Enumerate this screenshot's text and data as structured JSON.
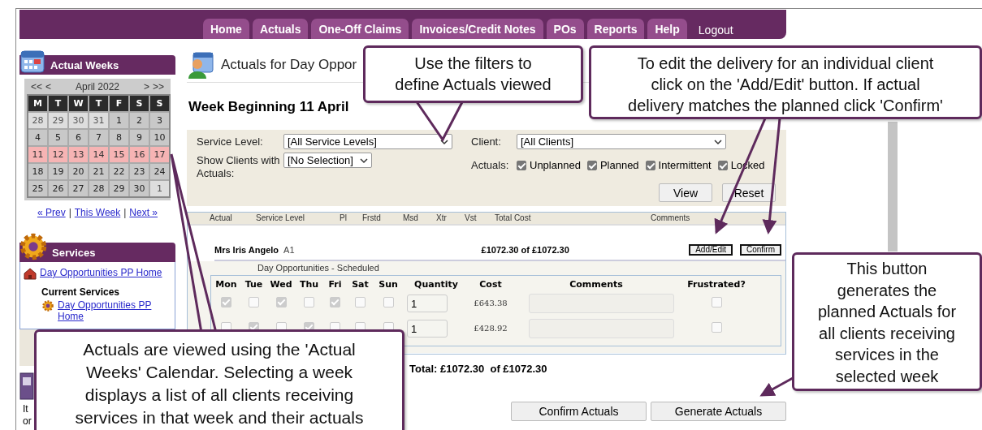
{
  "nav": [
    {
      "label": "Home",
      "kind": "tab"
    },
    {
      "label": "Actuals",
      "kind": "tab"
    },
    {
      "label": "One-Off Claims",
      "kind": "tab"
    },
    {
      "label": "Invoices/Credit Notes",
      "kind": "tab"
    },
    {
      "label": "POs",
      "kind": "tab"
    },
    {
      "label": "Reports",
      "kind": "tab"
    },
    {
      "label": "Help",
      "kind": "tab"
    },
    {
      "label": "Logout",
      "kind": "link"
    }
  ],
  "sidebar": {
    "calendar_panel": {
      "title": "Actual Weeks",
      "prev_year": "<<",
      "prev_month": "<",
      "month": "April 2022",
      "next_month": ">",
      "next_year": ">>",
      "weekdays": [
        "M",
        "T",
        "W",
        "T",
        "F",
        "S",
        "S"
      ],
      "weeks": [
        {
          "selected": false,
          "days": [
            {
              "label": "28",
              "other_month": true
            },
            {
              "label": "29",
              "other_month": true
            },
            {
              "label": "30",
              "other_month": true
            },
            {
              "label": "31",
              "other_month": true
            },
            {
              "label": "1",
              "other_month": false
            },
            {
              "label": "2",
              "other_month": false
            },
            {
              "label": "3",
              "other_month": false
            }
          ]
        },
        {
          "selected": false,
          "days": [
            {
              "label": "4",
              "other_month": false
            },
            {
              "label": "5",
              "other_month": false
            },
            {
              "label": "6",
              "other_month": false
            },
            {
              "label": "7",
              "other_month": false
            },
            {
              "label": "8",
              "other_month": false
            },
            {
              "label": "9",
              "other_month": false
            },
            {
              "label": "10",
              "other_month": false
            }
          ]
        },
        {
          "selected": true,
          "days": [
            {
              "label": "11",
              "other_month": false
            },
            {
              "label": "12",
              "other_month": false
            },
            {
              "label": "13",
              "other_month": false
            },
            {
              "label": "14",
              "other_month": false
            },
            {
              "label": "15",
              "other_month": false
            },
            {
              "label": "16",
              "other_month": false
            },
            {
              "label": "17",
              "other_month": false
            }
          ]
        },
        {
          "selected": false,
          "days": [
            {
              "label": "18",
              "other_month": false
            },
            {
              "label": "19",
              "other_month": false
            },
            {
              "label": "20",
              "other_month": false
            },
            {
              "label": "21",
              "other_month": false
            },
            {
              "label": "22",
              "other_month": false
            },
            {
              "label": "23",
              "other_month": false
            },
            {
              "label": "24",
              "other_month": false
            }
          ]
        },
        {
          "selected": false,
          "days": [
            {
              "label": "25",
              "other_month": false
            },
            {
              "label": "26",
              "other_month": false
            },
            {
              "label": "27",
              "other_month": false
            },
            {
              "label": "28",
              "other_month": false
            },
            {
              "label": "29",
              "other_month": false
            },
            {
              "label": "30",
              "other_month": false
            },
            {
              "label": "1",
              "other_month": true
            }
          ]
        }
      ],
      "links": [
        "« Prev",
        "This Week",
        "Next »"
      ],
      "separator": "|"
    },
    "services": {
      "title": "Services",
      "home_link": "Day Opportunities PP Home",
      "current_heading": "Current Services",
      "current_links": [
        "Day Opportunities PP Home"
      ]
    },
    "cut_text": [
      "It",
      "or"
    ]
  },
  "main": {
    "title": "Actuals for Day Oppor",
    "week_heading": "Week Beginning 11 April",
    "filters": {
      "service_level": {
        "label": "Service Level:",
        "value": "[All Service Levels]"
      },
      "client": {
        "label": "Client:",
        "value": "[All Clients]"
      },
      "show_clients": {
        "label": "Show Clients with Actuals:",
        "value": "[No Selection]"
      },
      "actuals": {
        "label": "Actuals:",
        "options": [
          {
            "label": "Unplanned",
            "checked": true
          },
          {
            "label": "Planned",
            "checked": true
          },
          {
            "label": "Intermittent",
            "checked": true
          },
          {
            "label": "Locked",
            "checked": true
          }
        ]
      },
      "buttons": [
        "View",
        "Reset"
      ]
    },
    "results": {
      "columns": [
        "Actual",
        "Service Level",
        "Pl",
        "Frstd",
        "Msd",
        "Xtr",
        "Vst",
        "Total Cost",
        "Comments"
      ],
      "clients": [
        {
          "name": "Mrs Iris Angelo",
          "code": "A1",
          "amount": "£1072.30 of £1072.30",
          "buttons": [
            "Add/Edit",
            "Confirm"
          ],
          "service": {
            "title": "Day Opportunities - Scheduled",
            "columns": [
              "Mon",
              "Tue",
              "Wed",
              "Thu",
              "Fri",
              "Sat",
              "Sun",
              "Quantity",
              "Cost",
              "Comments",
              "Frustrated?"
            ],
            "rows": [
              {
                "days": [
                  true,
                  false,
                  true,
                  false,
                  true,
                  false,
                  false
                ],
                "quantity": "1",
                "cost": "£643.38",
                "frustrated": false
              },
              {
                "days": [
                  false,
                  true,
                  false,
                  true,
                  false,
                  false,
                  false
                ],
                "quantity": "1",
                "cost": "£428.92",
                "frustrated": false
              }
            ]
          }
        }
      ]
    },
    "total": "Total: £1072.30  of £1072.30",
    "buttons": [
      "Confirm Actuals",
      "Generate Actuals"
    ]
  },
  "callouts": [
    {
      "text": "Use the filters to\ndefine Actuals viewed"
    },
    {
      "text": "To edit the delivery for an individual client\nclick on the 'Add/Edit' button. If actual\ndelivery matches the planned click 'Confirm'"
    },
    {
      "text": "This button\ngenerates the\nplanned Actuals for\nall clients receiving\nservices in the\nselected week"
    },
    {
      "text": "Actuals are viewed using the 'Actual\nWeeks' Calendar. Selecting a week\ndisplays a list of all clients receiving\nservices in that week and their actuals"
    }
  ]
}
